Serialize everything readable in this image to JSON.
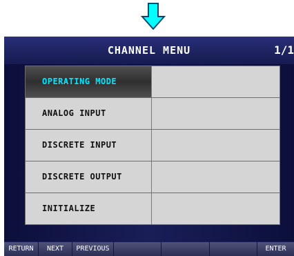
{
  "header": {
    "title": "CHANNEL MENU",
    "page": "1/1"
  },
  "menu": {
    "items": [
      {
        "label": "OPERATING MODE",
        "value": ""
      },
      {
        "label": "ANALOG INPUT",
        "value": ""
      },
      {
        "label": "DISCRETE INPUT",
        "value": ""
      },
      {
        "label": "DISCRETE OUTPUT",
        "value": ""
      },
      {
        "label": "INITIALIZE",
        "value": ""
      }
    ]
  },
  "footer": {
    "buttons": [
      "RETURN",
      "NEXT",
      "PREVIOUS",
      "",
      "",
      "",
      "ENTER"
    ]
  },
  "colors": {
    "screen_bg": "#1b1f5a",
    "selected_text": "#00e8ff",
    "arrow": "#00ffff"
  },
  "icons": {
    "indicator": "down-arrow-icon"
  }
}
